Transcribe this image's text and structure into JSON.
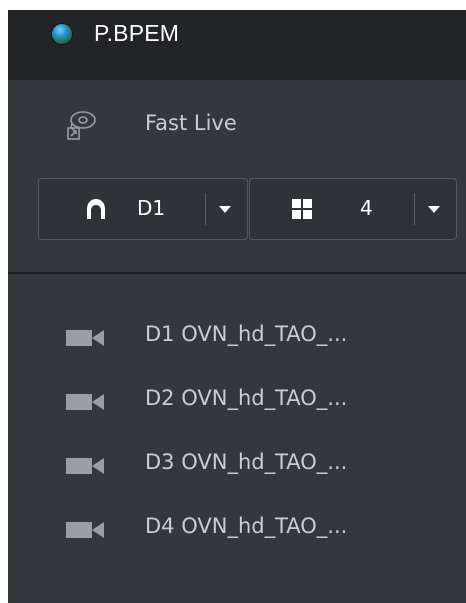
{
  "app": {
    "title": "P.BPEM",
    "status_color": "#2c8fc9"
  },
  "fast_live": {
    "label": "Fast Live",
    "icon": "fast-live-icon"
  },
  "selectors": {
    "device": {
      "value": "D1",
      "icon": "device-icon"
    },
    "layout": {
      "value": "4",
      "icon": "grid-icon"
    }
  },
  "channels": [
    {
      "label": "D1 OVN_hd_TAO_...",
      "icon": "camera-icon"
    },
    {
      "label": "D2 OVN_hd_TAO_...",
      "icon": "camera-icon"
    },
    {
      "label": "D3 OVN_hd_TAO_...",
      "icon": "camera-icon"
    },
    {
      "label": "D4 OVN_hd_TAO_...",
      "icon": "camera-icon"
    }
  ],
  "colors": {
    "panel": "#34373b",
    "titlebar": "#222427",
    "text": "#c9ccd0"
  }
}
